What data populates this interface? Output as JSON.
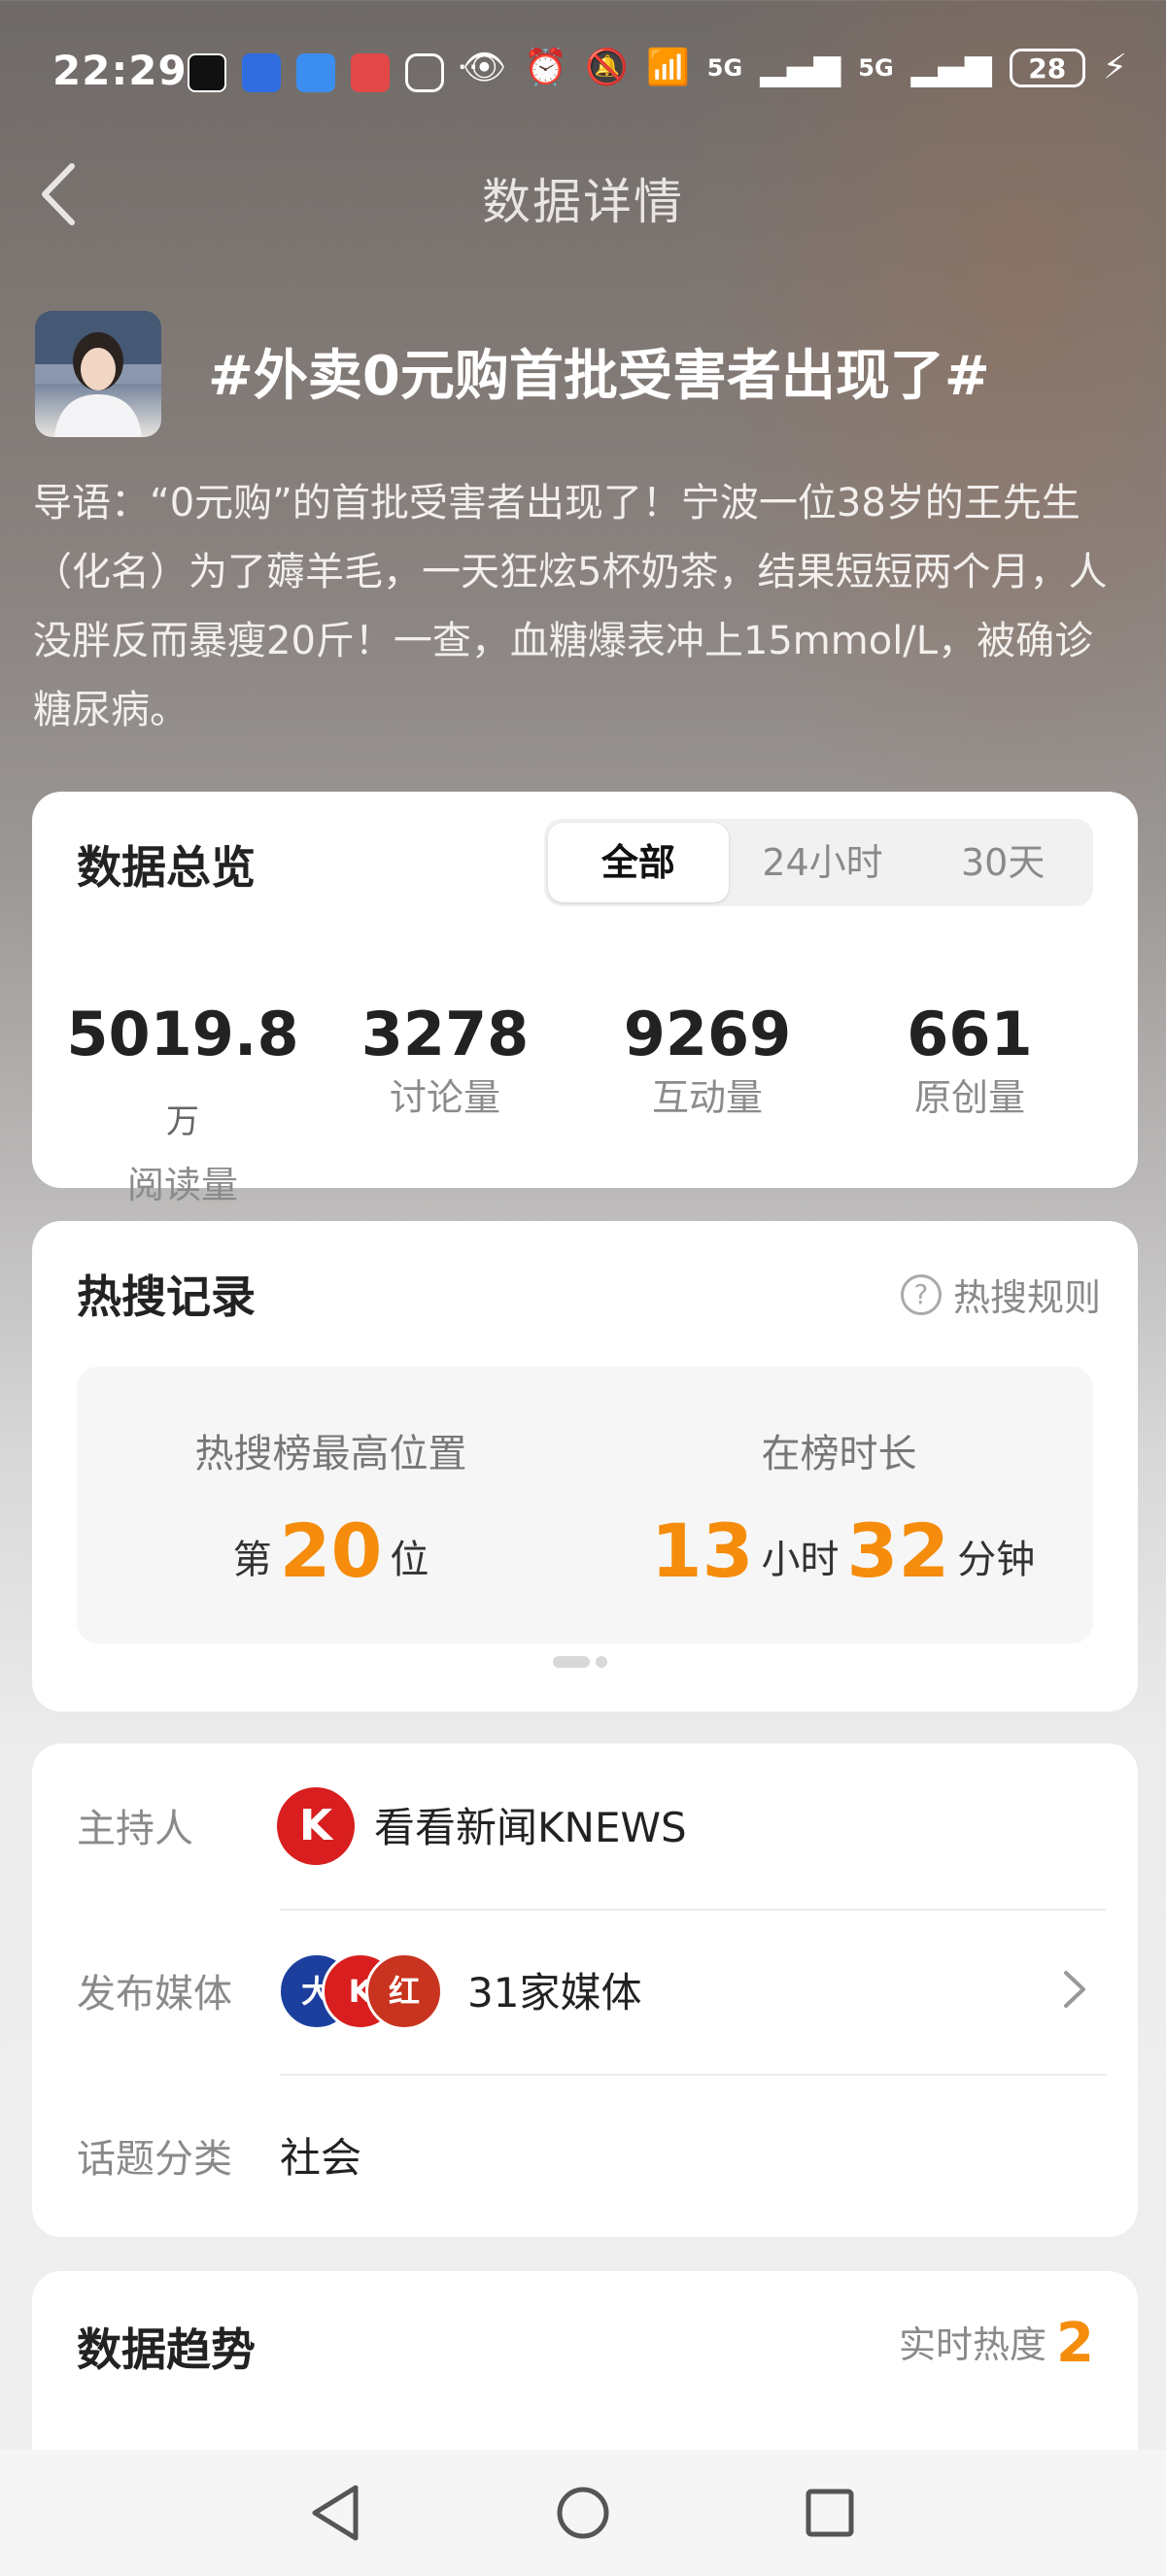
{
  "status_bar": {
    "time": "22:29",
    "network_5g_1": "5G",
    "network_5g_2": "5G",
    "battery": "28"
  },
  "header": {
    "title": "数据详情"
  },
  "topic": {
    "title": "#外卖0元购首批受害者出现了#",
    "intro": "导语：“0元购”的首批受害者出现了！宁波一位38岁的王先生（化名）为了薅羊毛，一天狂炫5杯奶茶，结果短短两个月，人没胖反而暴瘦20斤！一查，血糖爆表冲上15mmol/L，被确诊糖尿病。"
  },
  "overview": {
    "title": "数据总览",
    "tabs": [
      {
        "label": "全部"
      },
      {
        "label": "24小时"
      },
      {
        "label": "30天"
      }
    ],
    "stats": [
      {
        "value": "5019.8",
        "unit": "万",
        "label": "阅读量"
      },
      {
        "value": "3278",
        "unit": "",
        "label": "讨论量"
      },
      {
        "value": "9269",
        "unit": "",
        "label": "互动量"
      },
      {
        "value": "661",
        "unit": "",
        "label": "原创量"
      }
    ]
  },
  "hot_search": {
    "title": "热搜记录",
    "rules_link": "热搜规则",
    "highest_label": "热搜榜最高位置",
    "rank_prefix": "第",
    "rank": "20",
    "rank_suffix": "位",
    "duration_label": "在榜时长",
    "hours": "13",
    "hours_unit": "小时",
    "minutes": "32",
    "minutes_unit": "分钟"
  },
  "info": {
    "host_label": "主持人",
    "host_name": "看看新闻KNEWS",
    "media_label": "发布媒体",
    "media_count": "31家媒体",
    "category_label": "话题分类",
    "category": "社会"
  },
  "trend": {
    "title": "数据趋势",
    "live_label": "实时热度",
    "live_value": "2"
  },
  "colors": {
    "accent_orange": "#f58c0b",
    "card_bg": "#ffffff",
    "host_red": "#d81e1e"
  }
}
